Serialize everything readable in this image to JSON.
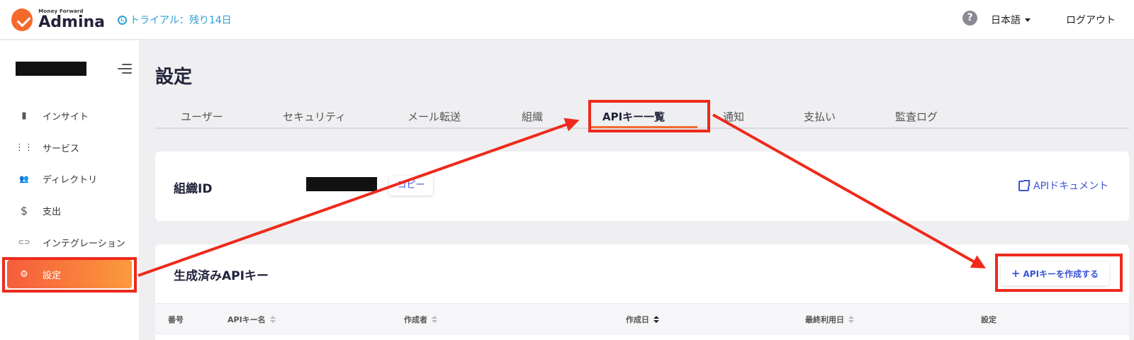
{
  "header": {
    "logo_sub": "Money Forward",
    "logo_main": "Admina",
    "trial_text": "トライアル：残り14日",
    "help_glyph": "?",
    "language": "日本語",
    "logout": "ログアウト"
  },
  "sidebar": {
    "items": [
      {
        "label": "インサイト",
        "icon": "bar-chart-icon",
        "glyph": "▮"
      },
      {
        "label": "サービス",
        "icon": "grid-icon",
        "glyph": "⋮⋮"
      },
      {
        "label": "ディレクトリ",
        "icon": "users-icon",
        "glyph": "👥"
      },
      {
        "label": "支出",
        "icon": "dollar-icon",
        "glyph": "$"
      },
      {
        "label": "インテグレーション",
        "icon": "link-icon",
        "glyph": "⊂⊃"
      },
      {
        "label": "設定",
        "icon": "gear-icon",
        "glyph": "⚙"
      }
    ],
    "active_index": 5
  },
  "main": {
    "page_title": "設定",
    "tabs": [
      {
        "label": "ユーザー"
      },
      {
        "label": "セキュリティ"
      },
      {
        "label": "メール転送"
      },
      {
        "label": "組織"
      },
      {
        "label": "APIキー一覧"
      },
      {
        "label": "通知"
      },
      {
        "label": "支払い"
      },
      {
        "label": "監査ログ"
      }
    ],
    "active_tab": 4,
    "org_card": {
      "label": "組織ID",
      "copy_button": "コピー",
      "doc_link": "APIドキュメント"
    },
    "api_card": {
      "title": "生成済みAPIキー",
      "create_button": "APIキーを作成する",
      "create_plus": "+",
      "columns": [
        {
          "label": "番号",
          "sortable": false
        },
        {
          "label": "APIキー名",
          "sortable": true
        },
        {
          "label": "作成者",
          "sortable": true
        },
        {
          "label": "作成日",
          "sortable": true,
          "active": true
        },
        {
          "label": "最終利用日",
          "sortable": true
        },
        {
          "label": "設定",
          "sortable": false
        }
      ]
    }
  },
  "colors": {
    "accent": "#f56a2c",
    "link": "#3a55d6",
    "highlight": "#ee2a1c"
  }
}
